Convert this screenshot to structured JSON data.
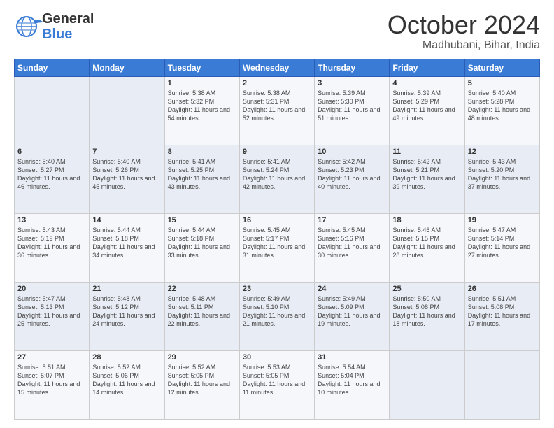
{
  "header": {
    "logo_line1": "General",
    "logo_line2": "Blue",
    "month": "October 2024",
    "location": "Madhubani, Bihar, India"
  },
  "weekdays": [
    "Sunday",
    "Monday",
    "Tuesday",
    "Wednesday",
    "Thursday",
    "Friday",
    "Saturday"
  ],
  "weeks": [
    [
      {
        "day": "",
        "info": ""
      },
      {
        "day": "",
        "info": ""
      },
      {
        "day": "1",
        "info": "Sunrise: 5:38 AM\nSunset: 5:32 PM\nDaylight: 11 hours and 54 minutes."
      },
      {
        "day": "2",
        "info": "Sunrise: 5:38 AM\nSunset: 5:31 PM\nDaylight: 11 hours and 52 minutes."
      },
      {
        "day": "3",
        "info": "Sunrise: 5:39 AM\nSunset: 5:30 PM\nDaylight: 11 hours and 51 minutes."
      },
      {
        "day": "4",
        "info": "Sunrise: 5:39 AM\nSunset: 5:29 PM\nDaylight: 11 hours and 49 minutes."
      },
      {
        "day": "5",
        "info": "Sunrise: 5:40 AM\nSunset: 5:28 PM\nDaylight: 11 hours and 48 minutes."
      }
    ],
    [
      {
        "day": "6",
        "info": "Sunrise: 5:40 AM\nSunset: 5:27 PM\nDaylight: 11 hours and 46 minutes."
      },
      {
        "day": "7",
        "info": "Sunrise: 5:40 AM\nSunset: 5:26 PM\nDaylight: 11 hours and 45 minutes."
      },
      {
        "day": "8",
        "info": "Sunrise: 5:41 AM\nSunset: 5:25 PM\nDaylight: 11 hours and 43 minutes."
      },
      {
        "day": "9",
        "info": "Sunrise: 5:41 AM\nSunset: 5:24 PM\nDaylight: 11 hours and 42 minutes."
      },
      {
        "day": "10",
        "info": "Sunrise: 5:42 AM\nSunset: 5:23 PM\nDaylight: 11 hours and 40 minutes."
      },
      {
        "day": "11",
        "info": "Sunrise: 5:42 AM\nSunset: 5:21 PM\nDaylight: 11 hours and 39 minutes."
      },
      {
        "day": "12",
        "info": "Sunrise: 5:43 AM\nSunset: 5:20 PM\nDaylight: 11 hours and 37 minutes."
      }
    ],
    [
      {
        "day": "13",
        "info": "Sunrise: 5:43 AM\nSunset: 5:19 PM\nDaylight: 11 hours and 36 minutes."
      },
      {
        "day": "14",
        "info": "Sunrise: 5:44 AM\nSunset: 5:18 PM\nDaylight: 11 hours and 34 minutes."
      },
      {
        "day": "15",
        "info": "Sunrise: 5:44 AM\nSunset: 5:18 PM\nDaylight: 11 hours and 33 minutes."
      },
      {
        "day": "16",
        "info": "Sunrise: 5:45 AM\nSunset: 5:17 PM\nDaylight: 11 hours and 31 minutes."
      },
      {
        "day": "17",
        "info": "Sunrise: 5:45 AM\nSunset: 5:16 PM\nDaylight: 11 hours and 30 minutes."
      },
      {
        "day": "18",
        "info": "Sunrise: 5:46 AM\nSunset: 5:15 PM\nDaylight: 11 hours and 28 minutes."
      },
      {
        "day": "19",
        "info": "Sunrise: 5:47 AM\nSunset: 5:14 PM\nDaylight: 11 hours and 27 minutes."
      }
    ],
    [
      {
        "day": "20",
        "info": "Sunrise: 5:47 AM\nSunset: 5:13 PM\nDaylight: 11 hours and 25 minutes."
      },
      {
        "day": "21",
        "info": "Sunrise: 5:48 AM\nSunset: 5:12 PM\nDaylight: 11 hours and 24 minutes."
      },
      {
        "day": "22",
        "info": "Sunrise: 5:48 AM\nSunset: 5:11 PM\nDaylight: 11 hours and 22 minutes."
      },
      {
        "day": "23",
        "info": "Sunrise: 5:49 AM\nSunset: 5:10 PM\nDaylight: 11 hours and 21 minutes."
      },
      {
        "day": "24",
        "info": "Sunrise: 5:49 AM\nSunset: 5:09 PM\nDaylight: 11 hours and 19 minutes."
      },
      {
        "day": "25",
        "info": "Sunrise: 5:50 AM\nSunset: 5:08 PM\nDaylight: 11 hours and 18 minutes."
      },
      {
        "day": "26",
        "info": "Sunrise: 5:51 AM\nSunset: 5:08 PM\nDaylight: 11 hours and 17 minutes."
      }
    ],
    [
      {
        "day": "27",
        "info": "Sunrise: 5:51 AM\nSunset: 5:07 PM\nDaylight: 11 hours and 15 minutes."
      },
      {
        "day": "28",
        "info": "Sunrise: 5:52 AM\nSunset: 5:06 PM\nDaylight: 11 hours and 14 minutes."
      },
      {
        "day": "29",
        "info": "Sunrise: 5:52 AM\nSunset: 5:05 PM\nDaylight: 11 hours and 12 minutes."
      },
      {
        "day": "30",
        "info": "Sunrise: 5:53 AM\nSunset: 5:05 PM\nDaylight: 11 hours and 11 minutes."
      },
      {
        "day": "31",
        "info": "Sunrise: 5:54 AM\nSunset: 5:04 PM\nDaylight: 11 hours and 10 minutes."
      },
      {
        "day": "",
        "info": ""
      },
      {
        "day": "",
        "info": ""
      }
    ]
  ]
}
